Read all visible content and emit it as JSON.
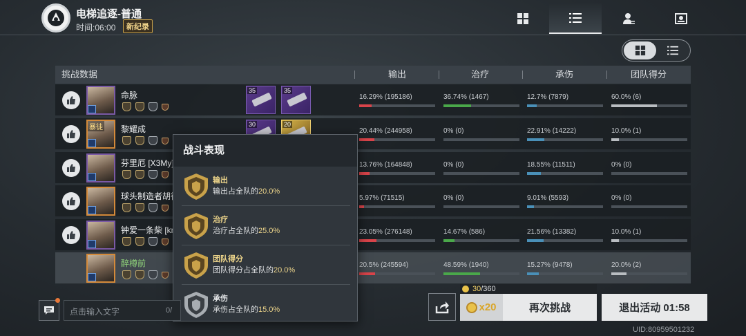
{
  "header": {
    "title": "电梯追逐-普通",
    "time": "时间:06:00",
    "record_badge": "新纪录"
  },
  "top_tabs": [
    {
      "icon": "grid-icon",
      "active": false
    },
    {
      "icon": "list-icon",
      "active": true
    },
    {
      "icon": "person-settings-icon",
      "active": false
    },
    {
      "icon": "profile-card-icon",
      "active": false
    }
  ],
  "table": {
    "headers": {
      "challenge": "挑战数据",
      "output": "输出",
      "heal": "治疗",
      "damage_taken": "承伤",
      "team_score": "团队得分"
    },
    "rows": [
      {
        "name": "命脉",
        "avatar_tag": "",
        "weapons": [
          "35",
          "35"
        ],
        "output": "16.29% (195186)",
        "output_pct": 0.1629,
        "heal": "36.74% (1467)",
        "heal_pct": 0.3674,
        "taken": "12.7% (7879)",
        "taken_pct": 0.127,
        "score": "60.0% (6)",
        "score_pct": 0.6
      },
      {
        "name": "黎耀成",
        "avatar_tag": "暴徒",
        "weapons": [
          "30",
          "20"
        ],
        "output": "20.44% (244958)",
        "output_pct": 0.2044,
        "heal": "0% (0)",
        "heal_pct": 0,
        "taken": "22.91% (14222)",
        "taken_pct": 0.2291,
        "score": "10.0% (1)",
        "score_pct": 0.1
      },
      {
        "name": "芬里厄 [X3My]",
        "avatar_tag": "",
        "weapons": [],
        "output": "13.76% (164848)",
        "output_pct": 0.1376,
        "heal": "0% (0)",
        "heal_pct": 0,
        "taken": "18.55% (11511)",
        "taken_pct": 0.1855,
        "score": "0% (0)",
        "score_pct": 0
      },
      {
        "name": "球头制造者胡德",
        "avatar_tag": "",
        "weapons": [],
        "output": "5.97% (71515)",
        "output_pct": 0.0597,
        "heal": "0% (0)",
        "heal_pct": 0,
        "taken": "9.01% (5593)",
        "taken_pct": 0.0901,
        "score": "0% (0)",
        "score_pct": 0
      },
      {
        "name": "钟爱一条柴 [kn",
        "avatar_tag": "",
        "weapons": [],
        "output": "23.05% (276148)",
        "output_pct": 0.2305,
        "heal": "14.67% (586)",
        "heal_pct": 0.1467,
        "taken": "21.56% (13382)",
        "taken_pct": 0.2156,
        "score": "10.0% (1)",
        "score_pct": 0.1
      },
      {
        "name": "醉樽前",
        "avatar_tag": "",
        "weapons": [],
        "output": "20.5% (245594)",
        "output_pct": 0.205,
        "heal": "48.59% (1940)",
        "heal_pct": 0.4859,
        "taken": "15.27% (9478)",
        "taken_pct": 0.1527,
        "score": "20.0% (2)",
        "score_pct": 0.2
      }
    ]
  },
  "popup": {
    "title": "战斗表现",
    "items": [
      {
        "title": "输出",
        "desc": "输出占全队的",
        "value": "20.0%",
        "tier": "gold"
      },
      {
        "title": "治疗",
        "desc": "治疗占全队的",
        "value": "25.0%",
        "tier": "gold"
      },
      {
        "title": "团队得分",
        "desc": "团队得分占全队的",
        "value": "20.0%",
        "tier": "gold"
      },
      {
        "title": "承伤",
        "desc": "承伤占全队的",
        "value": "15.0%",
        "tier": "silver"
      }
    ]
  },
  "chat": {
    "placeholder": "点击输入文字",
    "count": "0/"
  },
  "coins": {
    "current": "30",
    "max": "/360"
  },
  "retry": {
    "cost": "x20",
    "label": "再次挑战"
  },
  "exit": {
    "label": "退出活动 01:58"
  },
  "uid": "UID:80959501232",
  "colors": {
    "output": "#d9444a",
    "heal": "#4aa84a",
    "taken": "#4a90b8",
    "score": "#b9bdc1",
    "gold": "#ecd48a"
  }
}
